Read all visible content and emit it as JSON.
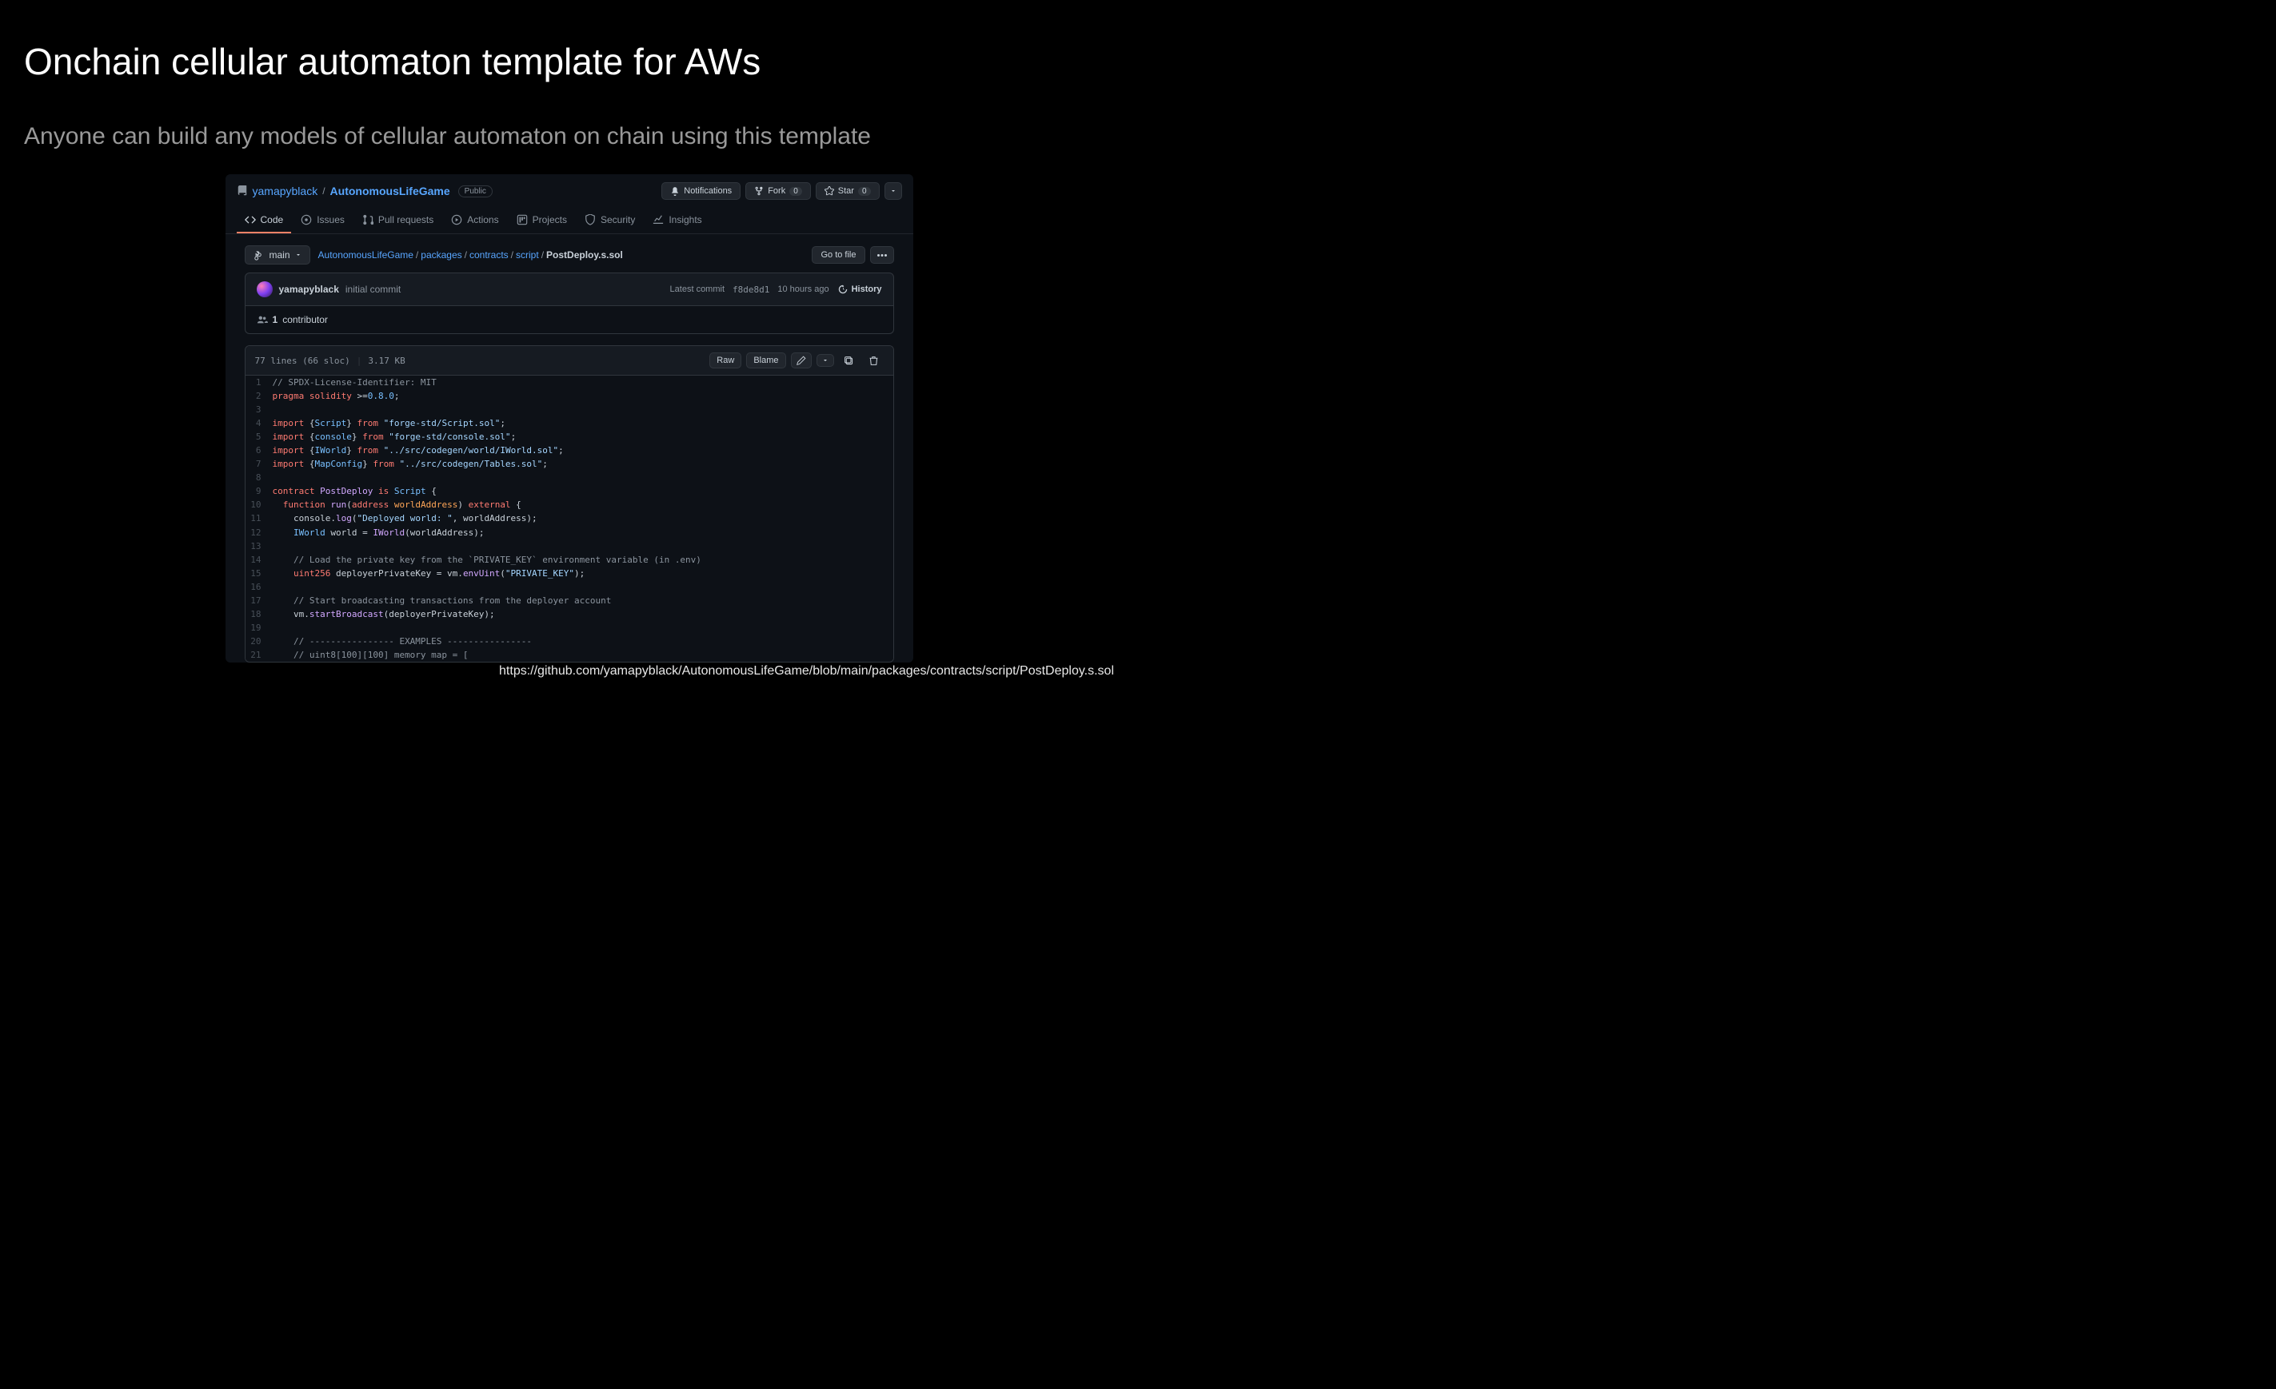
{
  "slide": {
    "title": "Onchain cellular automaton template for AWs",
    "subtitle": "Anyone can build any models of cellular automaton on chain using this template",
    "footer_url": "https://github.com/yamapyblack/AutonomousLifeGame/blob/main/packages/contracts/script/PostDeploy.s.sol"
  },
  "repo": {
    "owner": "yamapyblack",
    "name": "AutonomousLifeGame",
    "visibility": "Public"
  },
  "repo_actions": {
    "notifications": "Notifications",
    "fork": "Fork",
    "fork_count": "0",
    "star": "Star",
    "star_count": "0"
  },
  "tabs": {
    "code": "Code",
    "issues": "Issues",
    "pulls": "Pull requests",
    "actions": "Actions",
    "projects": "Projects",
    "security": "Security",
    "insights": "Insights"
  },
  "branch": {
    "label": "main"
  },
  "breadcrumb": {
    "root": "AutonomousLifeGame",
    "p1": "packages",
    "p2": "contracts",
    "p3": "script",
    "file": "PostDeploy.s.sol"
  },
  "subbar": {
    "gotofile": "Go to file"
  },
  "commit": {
    "author": "yamapyblack",
    "message": "initial commit",
    "latest_label": "Latest commit",
    "sha": "f8de8d1",
    "time": "10 hours ago",
    "history": "History"
  },
  "contributors": {
    "count": "1",
    "label": "contributor"
  },
  "file_meta": {
    "lines": "77 lines (66 sloc)",
    "size": "3.17 KB",
    "raw": "Raw",
    "blame": "Blame"
  },
  "code": [
    {
      "n": "1",
      "cls": "c-comment",
      "t": "// SPDX-License-Identifier: MIT"
    },
    {
      "n": "2",
      "html": "<span class='c-key'>pragma solidity</span> &gt;=<span class='c-type'>0.8.0</span>;"
    },
    {
      "n": "3",
      "t": ""
    },
    {
      "n": "4",
      "html": "<span class='c-key'>import</span> {<span class='c-type'>Script</span>} <span class='c-key'>from</span> <span class='c-str'>\"forge-std/Script.sol\"</span>;"
    },
    {
      "n": "5",
      "html": "<span class='c-key'>import</span> {<span class='c-type'>console</span>} <span class='c-key'>from</span> <span class='c-str'>\"forge-std/console.sol\"</span>;"
    },
    {
      "n": "6",
      "html": "<span class='c-key'>import</span> {<span class='c-type'>IWorld</span>} <span class='c-key'>from</span> <span class='c-str'>\"../src/codegen/world/IWorld.sol\"</span>;"
    },
    {
      "n": "7",
      "html": "<span class='c-key'>import</span> {<span class='c-type'>MapConfig</span>} <span class='c-key'>from</span> <span class='c-str'>\"../src/codegen/Tables.sol\"</span>;"
    },
    {
      "n": "8",
      "t": ""
    },
    {
      "n": "9",
      "html": "<span class='c-key'>contract</span> <span class='c-func'>PostDeploy</span> <span class='c-key'>is</span> <span class='c-type'>Script</span> {"
    },
    {
      "n": "10",
      "html": "  <span class='c-key'>function</span> <span class='c-func'>run</span>(<span class='c-key'>address</span> <span class='c-var'>worldAddress</span>) <span class='c-key'>external</span> {"
    },
    {
      "n": "11",
      "html": "    console.<span class='c-func'>log</span>(<span class='c-str'>\"Deployed world: \"</span>, worldAddress);"
    },
    {
      "n": "12",
      "html": "    <span class='c-type'>IWorld</span> world = <span class='c-func'>IWorld</span>(worldAddress);"
    },
    {
      "n": "13",
      "t": ""
    },
    {
      "n": "14",
      "cls": "c-comment",
      "t": "    // Load the private key from the `PRIVATE_KEY` environment variable (in .env)"
    },
    {
      "n": "15",
      "html": "    <span class='c-key'>uint256</span> deployerPrivateKey = vm.<span class='c-func'>envUint</span>(<span class='c-str'>\"PRIVATE_KEY\"</span>);"
    },
    {
      "n": "16",
      "t": ""
    },
    {
      "n": "17",
      "cls": "c-comment",
      "t": "    // Start broadcasting transactions from the deployer account"
    },
    {
      "n": "18",
      "html": "    vm.<span class='c-func'>startBroadcast</span>(deployerPrivateKey);"
    },
    {
      "n": "19",
      "t": ""
    },
    {
      "n": "20",
      "cls": "c-comment",
      "t": "    // ---------------- EXAMPLES ----------------"
    },
    {
      "n": "21",
      "cls": "c-comment",
      "t": "    // uint8[100][100] memory map = ["
    }
  ]
}
